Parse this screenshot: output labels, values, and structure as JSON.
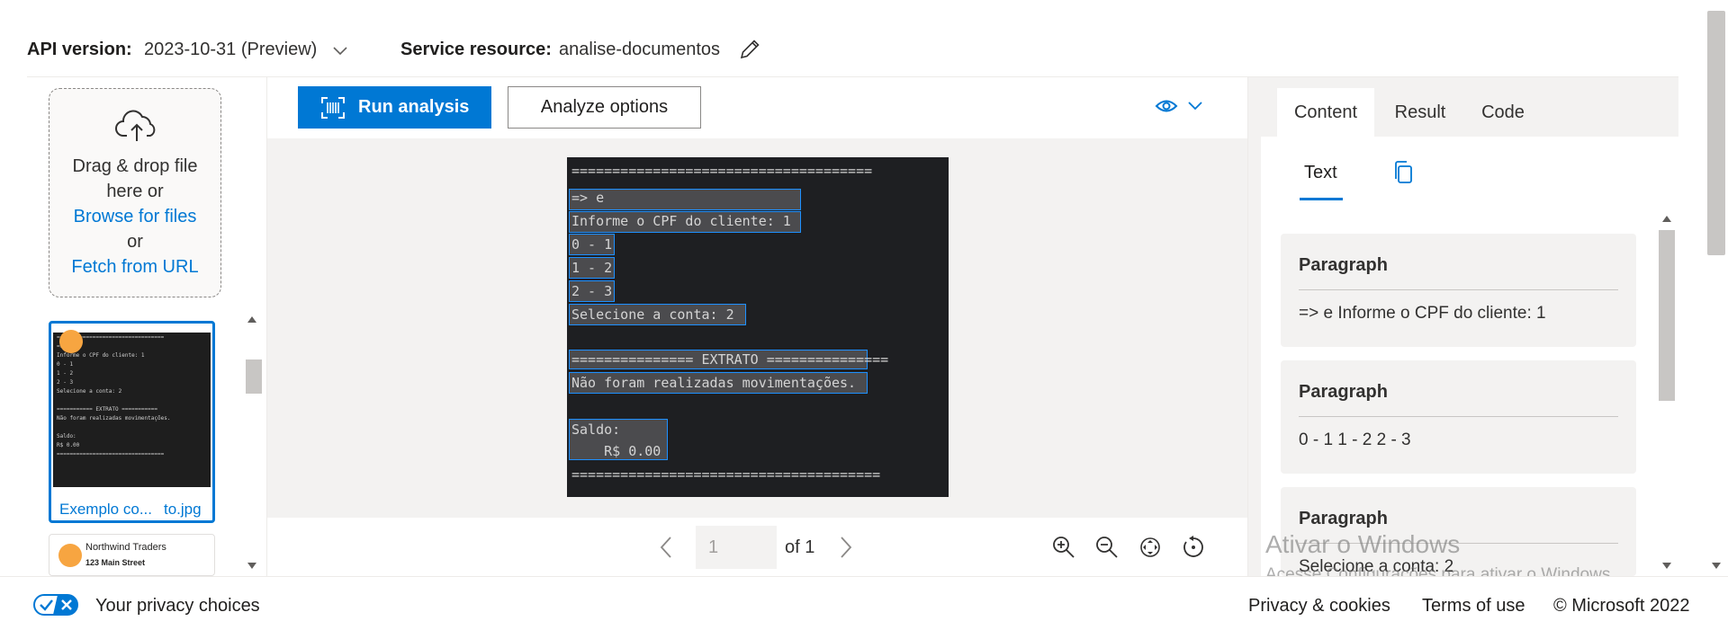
{
  "header": {
    "api_version_label": "API version:",
    "api_version_value": "2023-10-31 (Preview)",
    "service_resource_label": "Service resource:",
    "service_resource_value": "analise-documentos"
  },
  "upload": {
    "drag_line1": "Drag & drop file",
    "drag_line2": "here or",
    "browse_link": "Browse for files",
    "or_text": "or",
    "fetch_link": "Fetch from URL"
  },
  "thumbnails": [
    {
      "caption_left": "Exemplo co...",
      "caption_right": "to.jpg",
      "lines": [
        "=================================",
        "=>",
        "Informe o CPF do cliente: 1",
        "0 - 1",
        "1 - 2",
        "2 - 3",
        "Selecione a conta: 2",
        "",
        "=========== EXTRATO ===========",
        "Não foram realizadas movimentações.",
        "",
        "Saldo:",
        "    R$ 0.00",
        "================================="
      ]
    },
    {
      "title": "Northwind Traders",
      "subtitle": "123 Main Street"
    }
  ],
  "toolbar": {
    "run_label": "Run analysis",
    "analyze_label": "Analyze options"
  },
  "document": {
    "lines": [
      "=====================================",
      "=> e",
      "Informe o CPF do cliente: 1",
      "0 - 1",
      "1 - 2",
      "2 - 3",
      "Selecione a conta: 2",
      "",
      "=============== EXTRATO ===============",
      "Não foram realizadas movimentações.",
      "",
      "Saldo:",
      "    R$ 0.00",
      "======================================"
    ]
  },
  "pagination": {
    "current_page": "1",
    "of_label": "of 1"
  },
  "tabs": [
    "Content",
    "Result",
    "Code"
  ],
  "subtab": "Text",
  "paragraphs": [
    {
      "title": "Paragraph",
      "text": "=> e Informe o CPF do cliente: 1"
    },
    {
      "title": "Paragraph",
      "text": "0 - 1 1 - 2 2 - 3"
    },
    {
      "title": "Paragraph",
      "text": "Selecione a conta: 2"
    }
  ],
  "watermark": {
    "line1": "Ativar o Windows",
    "line2": "Acesse Configurações para ativar o Windows."
  },
  "footer": {
    "privacy_choices": "Your privacy choices",
    "privacy_cookies": "Privacy & cookies",
    "terms": "Terms of use",
    "copyright": "© Microsoft 2022"
  },
  "colors": {
    "accent": "#0078d4",
    "thumb_dot": "#f7a541",
    "doc_background": "#1e1f22",
    "highlight_border": "#1e90ff"
  }
}
